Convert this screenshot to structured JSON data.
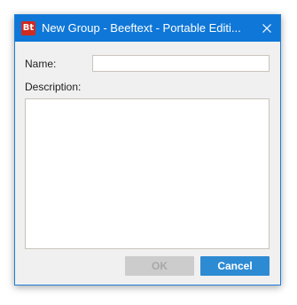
{
  "window": {
    "title": "New Group - Beeftext - Portable Editi...",
    "app_icon_text": "Bt"
  },
  "form": {
    "name_label": "Name:",
    "name_value": "",
    "description_label": "Description:",
    "description_value": ""
  },
  "buttons": {
    "ok_label": "OK",
    "ok_enabled": false,
    "cancel_label": "Cancel"
  },
  "colors": {
    "titlebar": "#0f77d7",
    "accent": "#2d8bd3",
    "app_icon": "#cf2b20"
  },
  "icons": {
    "app": "beeftext-app-icon",
    "close": "close-icon"
  }
}
